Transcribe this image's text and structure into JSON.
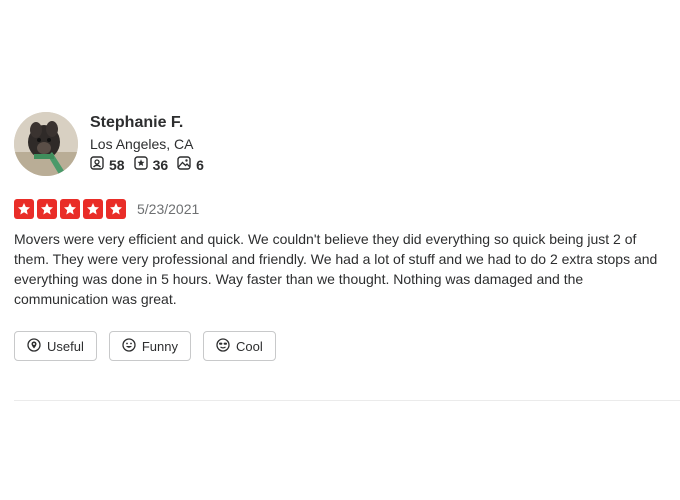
{
  "review": {
    "user": {
      "name": "Stephanie F.",
      "location": "Los Angeles, CA",
      "stats": [
        {
          "icon": "friends-icon",
          "value": "58"
        },
        {
          "icon": "reviews-icon",
          "value": "36"
        },
        {
          "icon": "photos-icon",
          "value": "6"
        }
      ]
    },
    "rating": {
      "stars": 5,
      "max": 5,
      "color": "#e92d28"
    },
    "date": "5/23/2021",
    "text": "Movers were very efficient and quick. We couldn't believe they did everything so quick being just 2 of them. They were very professional and friendly. We had a lot of stuff and we had to do 2 extra stops and everything was done in 5 hours. Way faster than we thought. Nothing was damaged and the communication was great.",
    "reactions": [
      {
        "icon": "useful-icon",
        "label": "Useful"
      },
      {
        "icon": "funny-icon",
        "label": "Funny"
      },
      {
        "icon": "cool-icon",
        "label": "Cool"
      }
    ]
  }
}
